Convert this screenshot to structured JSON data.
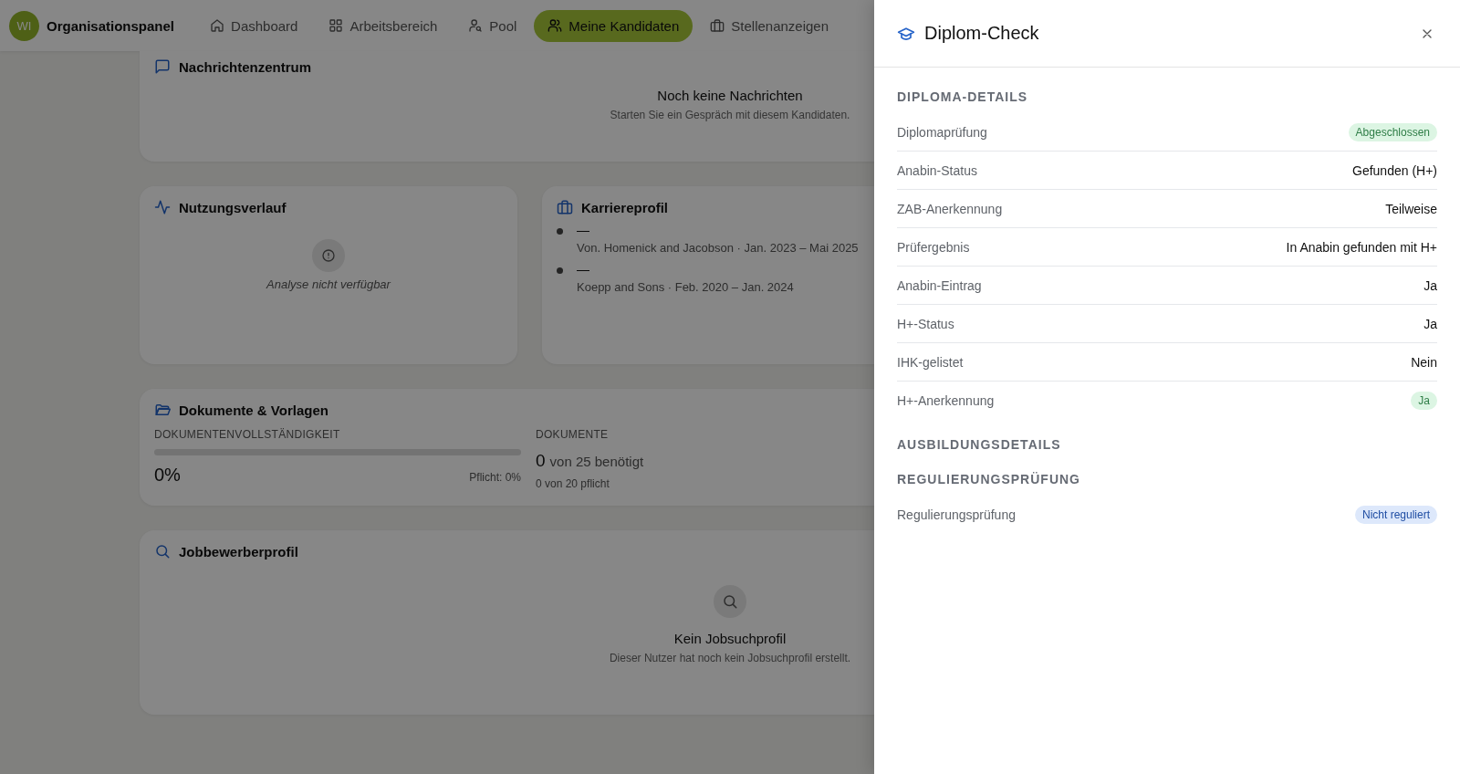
{
  "nav": {
    "avatar": "WI",
    "brand": "Organisationspanel",
    "items": [
      {
        "label": "Dashboard",
        "selected": false
      },
      {
        "label": "Arbeitsbereich",
        "selected": false
      },
      {
        "label": "Pool",
        "selected": false
      },
      {
        "label": "Meine Kandidaten",
        "selected": true
      },
      {
        "label": "Stellenanzeigen",
        "selected": false
      }
    ]
  },
  "messages": {
    "title": "Nachrichtenzentrum",
    "empty_title": "Noch keine Nachrichten",
    "empty_text": "Starten Sie ein Gespräch mit diesem Kandidaten."
  },
  "usage": {
    "title": "Nutzungsverlauf",
    "empty_text": "Analyse nicht verfügbar"
  },
  "career": {
    "title": "Karriereprofil",
    "entries": [
      {
        "title": "—",
        "subtitle": "Von. Homenick and Jacobson · Jan. 2023 – Mai 2025"
      },
      {
        "title": "—",
        "subtitle": "Koepp and Sons · Feb. 2020 – Jan. 2024"
      }
    ]
  },
  "documents": {
    "title": "Dokumente & Vorlagen",
    "completeness_label": "DOKUMENTENVOLLSTÄNDIGKEIT",
    "level": 0,
    "percent": "0%",
    "required": "Pflicht: 0%",
    "docs_label": "DOKUMENTE",
    "count": "0",
    "count_text": "von 25 benötigt",
    "required_text": "0 von 20 pflicht"
  },
  "job_profile": {
    "title": "Jobbewerberprofil",
    "empty_title": "Kein Jobsuchprofil",
    "empty_text": "Dieser Nutzer hat noch kein Jobsuchprofil erstellt."
  },
  "drawer": {
    "title": "Diplom-Check",
    "sections": [
      {
        "heading": "DIPLOMA-DETAILS",
        "rows": [
          {
            "label": "Diplomaprüfung",
            "value": "Abgeschlossen",
            "kind": "success-badge"
          },
          {
            "label": "Anabin-Status",
            "value": "Gefunden (H+)",
            "kind": "text"
          },
          {
            "label": "ZAB-Anerkennung",
            "value": "Teilweise",
            "kind": "text"
          },
          {
            "label": "Prüfergebnis",
            "value": "In Anabin gefunden mit H+",
            "kind": "text"
          },
          {
            "label": "Anabin-Eintrag",
            "value": "Ja",
            "kind": "text"
          },
          {
            "label": "H+-Status",
            "value": "Ja",
            "kind": "text"
          },
          {
            "label": "IHK-gelistet",
            "value": "Nein",
            "kind": "text"
          },
          {
            "label": "H+-Anerkennung",
            "value": "Ja",
            "kind": "success-badge"
          }
        ]
      },
      {
        "heading": "AUSBILDUNGSDETAILS"
      },
      {
        "heading": "REGULIERUNGSPRÜFUNG",
        "rows": [
          {
            "label": "Regulierungsprüfung",
            "value": "Nicht reguliert",
            "kind": "info-badge"
          }
        ]
      }
    ]
  }
}
